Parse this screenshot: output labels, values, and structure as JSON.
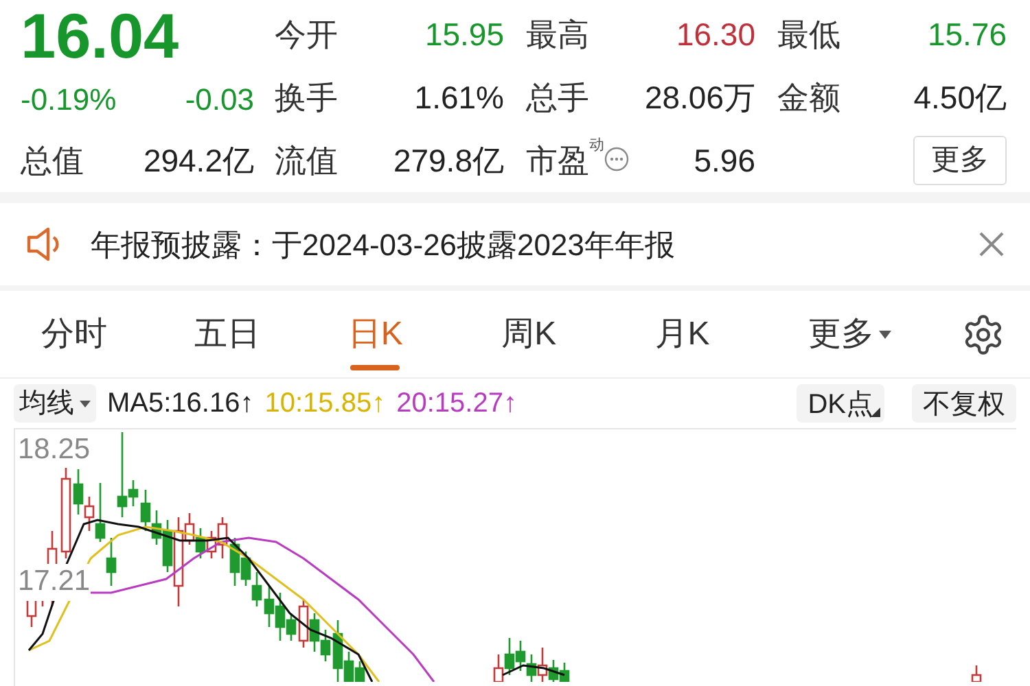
{
  "header": {
    "price": {
      "text": "16.04",
      "color": "#17962b"
    },
    "changes": [
      {
        "text": "-0.19%",
        "color": "#17962b"
      },
      {
        "text": "-0.03",
        "color": "#17962b"
      }
    ],
    "stats": [
      {
        "label": "今开",
        "value": "15.95",
        "color": "#17962b"
      },
      {
        "label": "最高",
        "value": "16.30",
        "color": "#c0303a"
      },
      {
        "label": "最低",
        "value": "15.76",
        "color": "#17962b"
      },
      {
        "label": "换手",
        "value": "1.61%",
        "color": "#222222"
      },
      {
        "label": "总手",
        "value": "28.06万",
        "color": "#222222"
      },
      {
        "label": "金额",
        "value": "4.50亿",
        "color": "#222222"
      }
    ],
    "bottom": [
      {
        "label": "总值",
        "value": "294.2亿"
      },
      {
        "label": "流值",
        "value": "279.8亿"
      },
      {
        "label": "市盈",
        "sup": "动",
        "value": "5.96"
      }
    ],
    "more_button": "更多"
  },
  "notice": {
    "text": "年报预披露：于2024-03-26披露2023年年报"
  },
  "tabs": [
    {
      "label": "分时",
      "selected": false
    },
    {
      "label": "五日",
      "selected": false
    },
    {
      "label": "日K",
      "selected": true
    },
    {
      "label": "周K",
      "selected": false
    },
    {
      "label": "月K",
      "selected": false
    },
    {
      "label": "更多",
      "selected": false,
      "kind": "dropdown"
    }
  ],
  "indicator_bar": {
    "selector": "均线",
    "legend": [
      {
        "text": "MA5:16.16↑",
        "color": "#222222"
      },
      {
        "text": "10:15.85↑",
        "color": "#d8b400"
      },
      {
        "text": "20:15.27↑",
        "color": "#b83cc0"
      }
    ],
    "buttons": [
      {
        "label": "DK点",
        "kind": "corner"
      },
      {
        "label": "不复权",
        "kind": "plain"
      }
    ]
  },
  "chart": {
    "price_labels": [
      "18.25",
      "17.21"
    ]
  }
}
